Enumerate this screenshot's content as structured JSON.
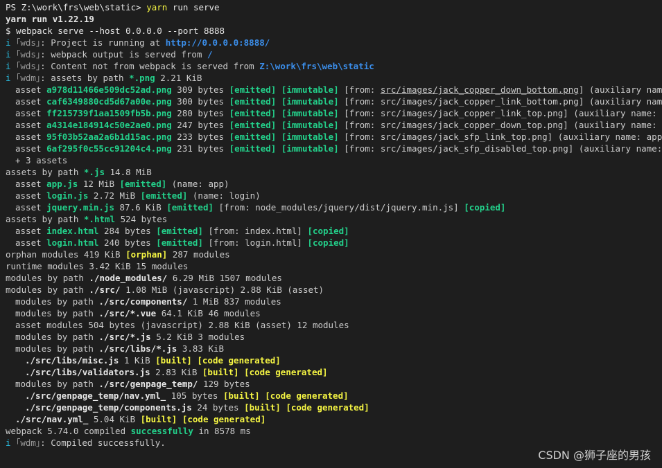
{
  "terminal": {
    "lines": [
      {
        "indent": 0,
        "segments": [
          [
            "PS Z:\\work\\frs\\web\\static> ",
            "white"
          ],
          [
            "yarn",
            "yellow"
          ],
          [
            " run serve",
            "white"
          ]
        ]
      },
      {
        "indent": 0,
        "segments": [
          [
            "yarn run v1.22.19",
            "white b"
          ]
        ]
      },
      {
        "indent": 0,
        "segments": [
          [
            "$ webpack serve --host 0.0.0.0 --port 8888",
            "white"
          ]
        ]
      },
      {
        "indent": 0,
        "segments": [
          [
            "i ",
            "cyan"
          ],
          [
            "｢wds｣",
            "gray"
          ],
          [
            ": Project is running at ",
            ""
          ],
          [
            "http://0.0.0.0:8888/",
            "blue b"
          ]
        ]
      },
      {
        "indent": 0,
        "segments": [
          [
            "i ",
            "cyan"
          ],
          [
            "｢wds｣",
            "gray"
          ],
          [
            ": webpack output is served from ",
            ""
          ],
          [
            "/",
            "blue b"
          ]
        ]
      },
      {
        "indent": 0,
        "segments": [
          [
            "i ",
            "cyan"
          ],
          [
            "｢wds｣",
            "gray"
          ],
          [
            ": Content not from webpack is served from ",
            ""
          ],
          [
            "Z:\\work\\frs\\web\\static",
            "blue b"
          ]
        ]
      },
      {
        "indent": 0,
        "segments": [
          [
            "i ",
            "cyan"
          ],
          [
            "｢wdm｣",
            "gray"
          ],
          [
            ": assets by path ",
            ""
          ],
          [
            "*.png",
            "green b"
          ],
          [
            " 2.21 KiB",
            ""
          ]
        ]
      },
      {
        "indent": 1,
        "segments": [
          [
            "asset ",
            ""
          ],
          [
            "a978d11466e509dc52ad.png",
            "green b"
          ],
          [
            " 309 bytes ",
            ""
          ],
          [
            "[emitted]",
            "green b"
          ],
          [
            " ",
            ""
          ],
          [
            "[immutable]",
            "green b"
          ],
          [
            " [from: ",
            ""
          ],
          [
            "src/images/jack_copper_down_bottom.png",
            "u"
          ],
          [
            "] (auxiliary name: app)",
            ""
          ]
        ]
      },
      {
        "indent": 1,
        "segments": [
          [
            "asset ",
            ""
          ],
          [
            "caf6349880cd5d67a00e.png",
            "green b"
          ],
          [
            " 300 bytes ",
            ""
          ],
          [
            "[emitted]",
            "green b"
          ],
          [
            " ",
            ""
          ],
          [
            "[immutable]",
            "green b"
          ],
          [
            " [from: src/images/jack_copper_link_bottom.png] (auxiliary name: app)",
            ""
          ]
        ]
      },
      {
        "indent": 1,
        "segments": [
          [
            "asset ",
            ""
          ],
          [
            "ff215739f1aa1509fb5b.png",
            "green b"
          ],
          [
            " 280 bytes ",
            ""
          ],
          [
            "[emitted]",
            "green b"
          ],
          [
            " ",
            ""
          ],
          [
            "[immutable]",
            "green b"
          ],
          [
            " [from: src/images/jack_copper_link_top.png] (auxiliary name: app)",
            ""
          ]
        ]
      },
      {
        "indent": 1,
        "segments": [
          [
            "asset ",
            ""
          ],
          [
            "a4314e184914c50e2ae0.png",
            "green b"
          ],
          [
            " 247 bytes ",
            ""
          ],
          [
            "[emitted]",
            "green b"
          ],
          [
            " ",
            ""
          ],
          [
            "[immutable]",
            "green b"
          ],
          [
            " [from: src/images/jack_copper_down_top.png] (auxiliary name: app)",
            ""
          ]
        ]
      },
      {
        "indent": 1,
        "segments": [
          [
            "asset ",
            ""
          ],
          [
            "95f03b52aa2a6b1d15ac.png",
            "green b"
          ],
          [
            " 233 bytes ",
            ""
          ],
          [
            "[emitted]",
            "green b"
          ],
          [
            " ",
            ""
          ],
          [
            "[immutable]",
            "green b"
          ],
          [
            " [from: src/images/jack_sfp_link_top.png] (auxiliary name: app)",
            ""
          ]
        ]
      },
      {
        "indent": 1,
        "segments": [
          [
            "asset ",
            ""
          ],
          [
            "6af295f0c55cc91204c4.png",
            "green b"
          ],
          [
            " 231 bytes ",
            ""
          ],
          [
            "[emitted]",
            "green b"
          ],
          [
            " ",
            ""
          ],
          [
            "[immutable]",
            "green b"
          ],
          [
            " [from: src/images/jack_sfp_disabled_top.png] (auxiliary name: app)",
            ""
          ]
        ]
      },
      {
        "indent": 1,
        "segments": [
          [
            "+ 3 assets",
            ""
          ]
        ]
      },
      {
        "indent": 0,
        "segments": [
          [
            "assets by path ",
            ""
          ],
          [
            "*.js",
            "green b"
          ],
          [
            " 14.8 MiB",
            ""
          ]
        ]
      },
      {
        "indent": 1,
        "segments": [
          [
            "asset ",
            ""
          ],
          [
            "app.js",
            "green b"
          ],
          [
            " 12 MiB ",
            ""
          ],
          [
            "[emitted]",
            "green b"
          ],
          [
            " (name: app)",
            ""
          ]
        ]
      },
      {
        "indent": 1,
        "segments": [
          [
            "asset ",
            ""
          ],
          [
            "login.js",
            "green b"
          ],
          [
            " 2.72 MiB ",
            ""
          ],
          [
            "[emitted]",
            "green b"
          ],
          [
            " (name: login)",
            ""
          ]
        ]
      },
      {
        "indent": 1,
        "segments": [
          [
            "asset ",
            ""
          ],
          [
            "jquery.min.js",
            "green b"
          ],
          [
            " 87.6 KiB ",
            ""
          ],
          [
            "[emitted]",
            "green b"
          ],
          [
            " [from: node_modules/jquery/dist/jquery.min.js] ",
            ""
          ],
          [
            "[copied]",
            "green b"
          ]
        ]
      },
      {
        "indent": 0,
        "segments": [
          [
            "assets by path ",
            ""
          ],
          [
            "*.html",
            "green b"
          ],
          [
            " 524 bytes",
            ""
          ]
        ]
      },
      {
        "indent": 1,
        "segments": [
          [
            "asset ",
            ""
          ],
          [
            "index.html",
            "green b"
          ],
          [
            " 284 bytes ",
            ""
          ],
          [
            "[emitted]",
            "green b"
          ],
          [
            " [from: index.html] ",
            ""
          ],
          [
            "[copied]",
            "green b"
          ]
        ]
      },
      {
        "indent": 1,
        "segments": [
          [
            "asset ",
            ""
          ],
          [
            "login.html",
            "green b"
          ],
          [
            " 240 bytes ",
            ""
          ],
          [
            "[emitted]",
            "green b"
          ],
          [
            " [from: login.html] ",
            ""
          ],
          [
            "[copied]",
            "green b"
          ]
        ]
      },
      {
        "indent": 0,
        "segments": [
          [
            "orphan modules 419 KiB ",
            ""
          ],
          [
            "[orphan]",
            "yellow b"
          ],
          [
            " 287 modules",
            ""
          ]
        ]
      },
      {
        "indent": 0,
        "segments": [
          [
            "runtime modules 3.42 KiB 15 modules",
            ""
          ]
        ]
      },
      {
        "indent": 0,
        "segments": [
          [
            "modules by path ",
            ""
          ],
          [
            "./node_modules/",
            "white b"
          ],
          [
            " 6.29 MiB 1507 modules",
            ""
          ]
        ]
      },
      {
        "indent": 0,
        "segments": [
          [
            "modules by path ",
            ""
          ],
          [
            "./src/",
            "white b"
          ],
          [
            " 1.08 MiB (javascript) 2.88 KiB (asset)",
            ""
          ]
        ]
      },
      {
        "indent": 1,
        "segments": [
          [
            "modules by path ",
            ""
          ],
          [
            "./src/components/",
            "white b"
          ],
          [
            " 1 MiB 837 modules",
            ""
          ]
        ]
      },
      {
        "indent": 1,
        "segments": [
          [
            "modules by path ",
            ""
          ],
          [
            "./src/*.vue",
            "white b"
          ],
          [
            " 64.1 KiB 46 modules",
            ""
          ]
        ]
      },
      {
        "indent": 1,
        "segments": [
          [
            "asset modules 504 bytes (javascript) 2.88 KiB (asset) 12 modules",
            ""
          ]
        ]
      },
      {
        "indent": 1,
        "segments": [
          [
            "modules by path ",
            ""
          ],
          [
            "./src/*.js",
            "white b"
          ],
          [
            " 5.2 KiB 3 modules",
            ""
          ]
        ]
      },
      {
        "indent": 1,
        "segments": [
          [
            "modules by path ",
            ""
          ],
          [
            "./src/libs/*.js",
            "white b"
          ],
          [
            " 3.83 KiB",
            ""
          ]
        ]
      },
      {
        "indent": 2,
        "segments": [
          [
            "./src/libs/misc.js",
            "white b"
          ],
          [
            " 1 KiB ",
            ""
          ],
          [
            "[built]",
            "yellow b"
          ],
          [
            " ",
            ""
          ],
          [
            "[code generated]",
            "yellow b"
          ]
        ]
      },
      {
        "indent": 2,
        "segments": [
          [
            "./src/libs/validators.js",
            "white b"
          ],
          [
            " 2.83 KiB ",
            ""
          ],
          [
            "[built]",
            "yellow b"
          ],
          [
            " ",
            ""
          ],
          [
            "[code generated]",
            "yellow b"
          ]
        ]
      },
      {
        "indent": 1,
        "segments": [
          [
            "modules by path ",
            ""
          ],
          [
            "./src/genpage_temp/",
            "white b"
          ],
          [
            " 129 bytes",
            ""
          ]
        ]
      },
      {
        "indent": 2,
        "segments": [
          [
            "./src/genpage_temp/nav.yml_",
            "white b"
          ],
          [
            " 105 bytes ",
            ""
          ],
          [
            "[built]",
            "yellow b"
          ],
          [
            " ",
            ""
          ],
          [
            "[code generated]",
            "yellow b"
          ]
        ]
      },
      {
        "indent": 2,
        "segments": [
          [
            "./src/genpage_temp/components.js",
            "white b"
          ],
          [
            " 24 bytes ",
            ""
          ],
          [
            "[built]",
            "yellow b"
          ],
          [
            " ",
            ""
          ],
          [
            "[code generated]",
            "yellow b"
          ]
        ]
      },
      {
        "indent": 1,
        "segments": [
          [
            "./src/nav.yml_",
            "white b"
          ],
          [
            " 5.04 KiB ",
            ""
          ],
          [
            "[built]",
            "yellow b"
          ],
          [
            " ",
            ""
          ],
          [
            "[code generated]",
            "yellow b"
          ]
        ]
      },
      {
        "indent": 0,
        "segments": [
          [
            "webpack 5.74.0 compiled ",
            ""
          ],
          [
            "successfully",
            "green b"
          ],
          [
            " in 8578 ms",
            ""
          ]
        ]
      },
      {
        "indent": 0,
        "segments": [
          [
            "i ",
            "cyan"
          ],
          [
            "｢wdm｣",
            "gray"
          ],
          [
            ": Compiled successfully.",
            ""
          ]
        ]
      }
    ]
  },
  "watermark": "CSDN @狮子座的男孩",
  "colors": {
    "background": "#1e1e1e",
    "text": "#cccccc",
    "green": "#23d18b",
    "yellow": "#f5f543",
    "blue": "#3b8eea",
    "cyan": "#29b8db"
  },
  "icons": {
    "cursor": "block-cursor-icon"
  }
}
